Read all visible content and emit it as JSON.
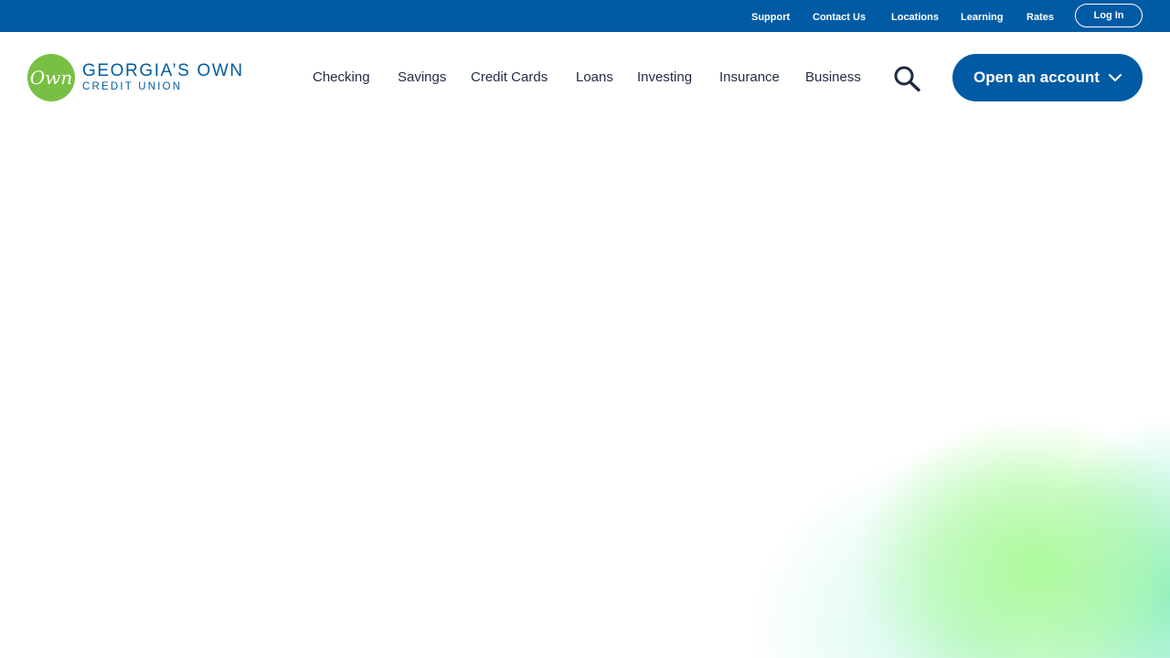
{
  "utility_nav": {
    "support": "Support",
    "contact_us": "Contact Us",
    "locations": "Locations",
    "learning": "Learning",
    "rates": "Rates",
    "login": "Log In"
  },
  "logo": {
    "mark": "Own",
    "name": "GEORGIA’S OWN",
    "sub": "CREDIT UNION"
  },
  "main_nav": {
    "items": [
      "Checking",
      "Savings",
      "Credit Cards",
      "Loans",
      "Investing",
      "Insurance",
      "Business"
    ]
  },
  "cta": {
    "open_account": "Open an account"
  },
  "colors": {
    "brand_blue": "#005ba4",
    "brand_green": "#78c043",
    "nav_text": "#1f2a44"
  },
  "icons": [
    "search-icon",
    "chevron-down-icon"
  ]
}
